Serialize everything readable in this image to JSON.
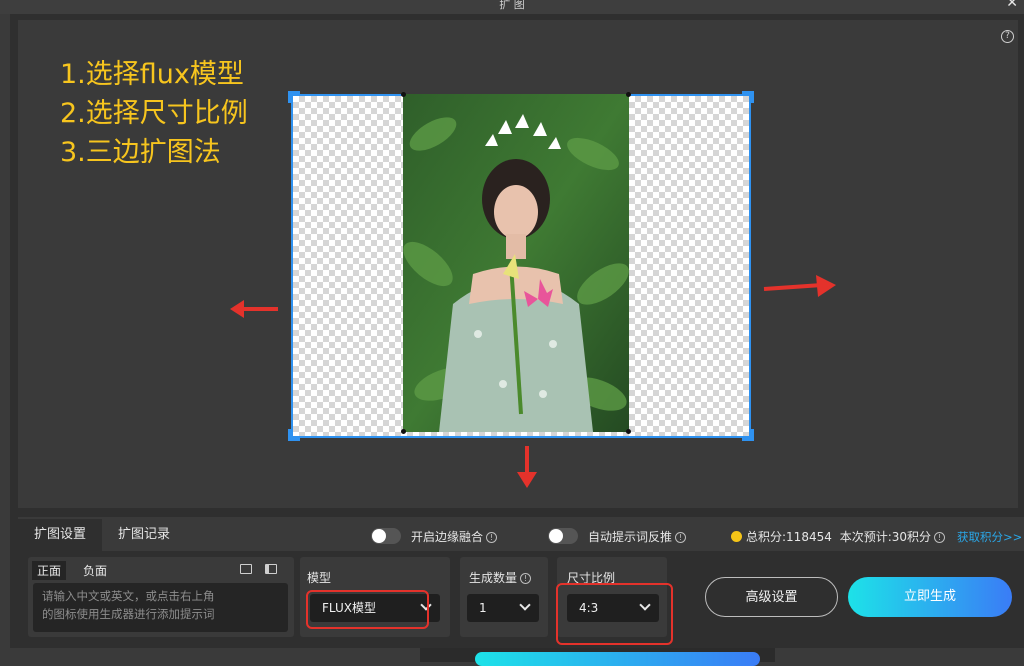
{
  "window": {
    "title": "扩 图",
    "close_glyph": "✕"
  },
  "help_glyph": "?",
  "instructions": [
    "1.选择flux模型",
    "2.选择尺寸比例",
    "3.三边扩图法"
  ],
  "colors": {
    "accent_blue": "#2f92f0",
    "annotation_red": "#e4322b",
    "instruction_yellow": "#f7c51e",
    "generate_gradient_start": "#1de2e8",
    "generate_gradient_end": "#3a7cf6",
    "points_dot": "#f5c518"
  },
  "tabs": [
    {
      "label": "扩图设置",
      "active": true
    },
    {
      "label": "扩图记录",
      "active": false
    }
  ],
  "toggles": {
    "edge_blend": {
      "label": "开启边缘融合",
      "on": false
    },
    "auto_prompt": {
      "label": "自动提示词反推",
      "on": false
    }
  },
  "points": {
    "total": "总积分:118454",
    "estimate": "本次预计:30积分",
    "get_link": "获取积分>>"
  },
  "prompt": {
    "tab_positive": "正面",
    "tab_negative": "负面",
    "placeholder": "请输入中文或英文，或点击右上角\n的图标使用生成器进行添加提示词"
  },
  "model": {
    "label": "模型",
    "value": "FLUX模型"
  },
  "count": {
    "label": "生成数量",
    "value": "1"
  },
  "ratio": {
    "label": "尺寸比例",
    "value": "4:3"
  },
  "buttons": {
    "advanced": "高级设置",
    "generate": "立即生成"
  }
}
